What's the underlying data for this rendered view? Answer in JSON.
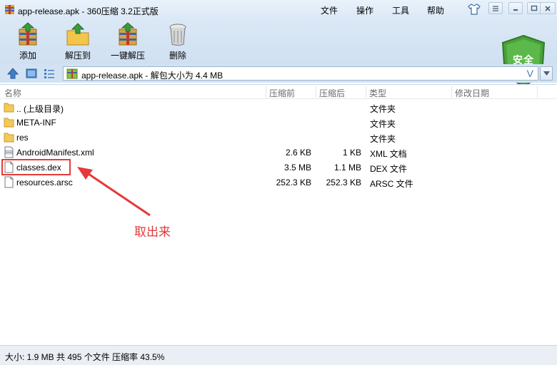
{
  "window": {
    "title": "app-release.apk - 360压缩 3.2正式版"
  },
  "menu": [
    "文件",
    "操作",
    "工具",
    "帮助"
  ],
  "toolbar": [
    {
      "label": "添加",
      "icon": "add-archive-icon"
    },
    {
      "label": "解压到",
      "icon": "extract-to-icon"
    },
    {
      "label": "一键解压",
      "icon": "one-click-extract-icon"
    },
    {
      "label": "删除",
      "icon": "delete-trash-icon"
    }
  ],
  "safety_badge": {
    "label": "安全",
    "color": "#4aa13a"
  },
  "address": {
    "text": "app-release.apk - 解包大小为 4.4 MB",
    "v_label": "V"
  },
  "columns": [
    "名称",
    "压缩前",
    "压缩后",
    "类型",
    "修改日期"
  ],
  "files": [
    {
      "name": ".. (上级目录)",
      "size": "",
      "packed": "",
      "type": "文件夹",
      "icon": "folder-icon"
    },
    {
      "name": "META-INF",
      "size": "",
      "packed": "",
      "type": "文件夹",
      "icon": "folder-icon"
    },
    {
      "name": "res",
      "size": "",
      "packed": "",
      "type": "文件夹",
      "icon": "folder-icon"
    },
    {
      "name": "AndroidManifest.xml",
      "size": "2.6 KB",
      "packed": "1 KB",
      "type": "XML 文档",
      "icon": "xml-file-icon"
    },
    {
      "name": "classes.dex",
      "size": "3.5 MB",
      "packed": "1.1 MB",
      "type": "DEX 文件",
      "icon": "file-icon"
    },
    {
      "name": "resources.arsc",
      "size": "252.3 KB",
      "packed": "252.3 KB",
      "type": "ARSC 文件",
      "icon": "file-icon"
    }
  ],
  "annotation": {
    "text": "取出来",
    "color": "#e5383b"
  },
  "status": "大小: 1.9 MB 共 495 个文件 压缩率 43.5%"
}
